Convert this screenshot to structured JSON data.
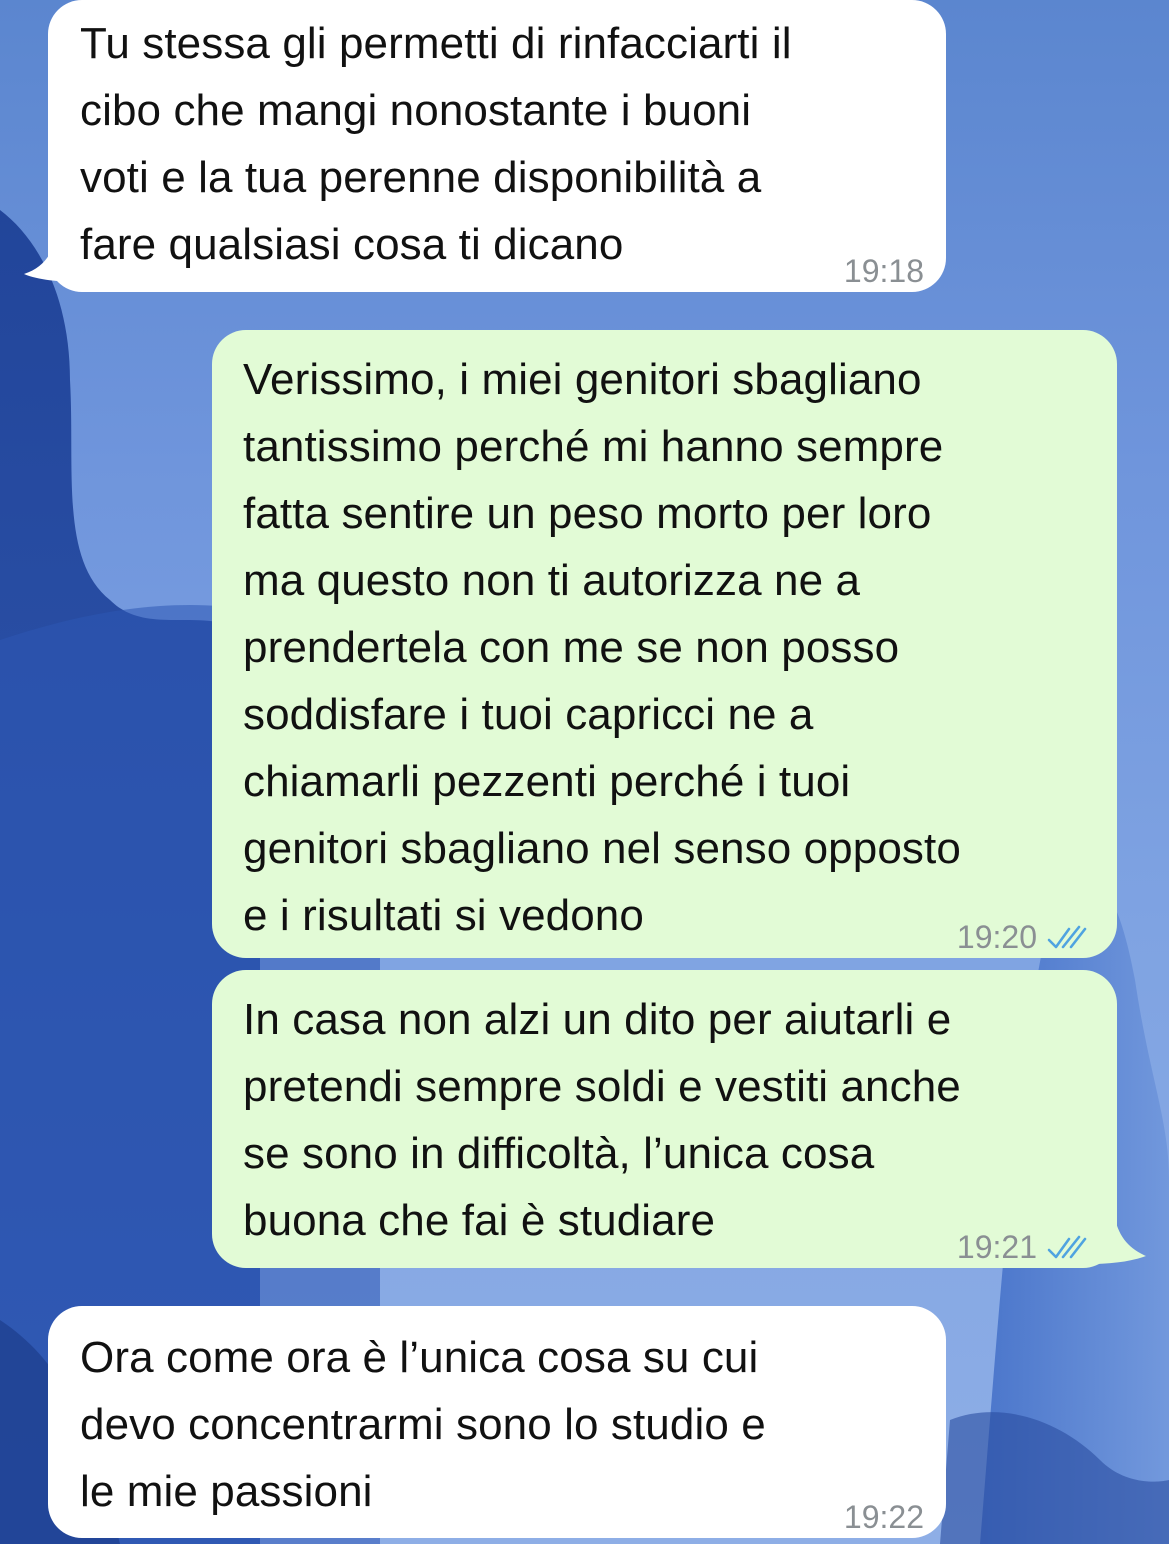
{
  "chat": {
    "messages": [
      {
        "direction": "incoming",
        "text": "Tu stessa gli permetti di rinfacciarti il\ncibo che mangi nonostante i buoni\nvoti e la tua perenne disponibilità a\nfare qualsiasi cosa ti dicano",
        "time": "19:18"
      },
      {
        "direction": "outgoing",
        "text": "Verissimo, i miei genitori sbagliano\ntantissimo perché mi hanno sempre\nfatta sentire un peso morto per loro\nma questo non ti autorizza ne a\nprendertela con me se non posso\nsoddisfare i tuoi capricci ne a\nchiamarli pezzenti perché i tuoi\ngenitori sbagliano nel senso opposto\ne i risultati si vedono",
        "time": "19:20",
        "status": "read"
      },
      {
        "direction": "outgoing",
        "text": "In casa non alzi un dito per aiutarli e\npretendi sempre soldi e vestiti anche\nse sono in difficoltà, l’unica cosa\nbuona che fai è studiare",
        "time": "19:21",
        "status": "read"
      },
      {
        "direction": "incoming",
        "text": "Ora come ora è l’unica cosa su cui\ndevo concentrarmi sono lo studio e\nle mie passioni",
        "time": "19:22"
      }
    ]
  },
  "colors": {
    "incoming_bubble": "#ffffff",
    "outgoing_bubble": "#e2fbd6",
    "read_ticks": "#4fa3e0",
    "timestamp": "#8a8f93"
  },
  "icons": {
    "read_receipt": "double-check-icon"
  }
}
